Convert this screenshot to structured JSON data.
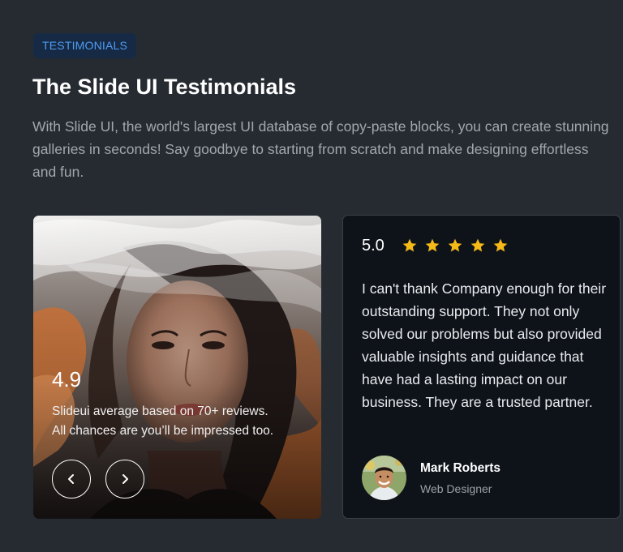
{
  "header": {
    "badge": "TESTIMONIALS",
    "title": "The Slide UI Testimonials",
    "description": "With Slide UI, the world's largest UI database of copy-paste blocks, you can create stunning galleries in seconds! Say goodbye to starting from scratch and make designing effortless and fun."
  },
  "image_card": {
    "rating": "4.9",
    "caption_line1": "Slideui average based on 70+ reviews.",
    "caption_line2": "All chances are you’ll be impressed too.",
    "prev_icon": "chevron-left-icon",
    "next_icon": "chevron-right-icon"
  },
  "testimonial": {
    "score": "5.0",
    "stars": 5,
    "star_color": "#f5b918",
    "quote": "I can't thank Company enough for their outstanding support. They not only solved our problems but also provided valuable insights and guidance that have had a lasting impact on our business. They are a trusted partner.",
    "author_name": "Mark Roberts",
    "author_role": "Web Designer"
  },
  "colors": {
    "page_background": "#262b32",
    "accent": "#4f9cf2",
    "card_background": "#0e131a"
  }
}
